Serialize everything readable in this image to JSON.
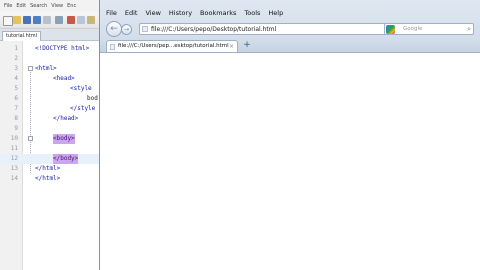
{
  "editor": {
    "menu": [
      "File",
      "Edit",
      "Search",
      "View",
      "Enc"
    ],
    "tab_label": "tutorial.html",
    "lines": [
      {
        "num": "1",
        "text": "<!DOCTYPE html>"
      },
      {
        "num": "2",
        "text": ""
      },
      {
        "num": "3",
        "text": "<html>"
      },
      {
        "num": "4",
        "text": "<head>"
      },
      {
        "num": "5",
        "text": "<style"
      },
      {
        "num": "6",
        "text": "bod"
      },
      {
        "num": "7",
        "text": "</style"
      },
      {
        "num": "8",
        "text": "</head>"
      },
      {
        "num": "9",
        "text": ""
      },
      {
        "num": "10",
        "text": "<body>"
      },
      {
        "num": "11",
        "text": ""
      },
      {
        "num": "12",
        "text": "</body>"
      },
      {
        "num": "13",
        "text": "</html>"
      },
      {
        "num": "14",
        "text": "</html>"
      }
    ]
  },
  "browser": {
    "menu": [
      "File",
      "Edit",
      "View",
      "History",
      "Bookmarks",
      "Tools",
      "Help"
    ],
    "url": "file:///C:/Users/pepo/Desktop/tutorial.html",
    "search_placeholder": "Google",
    "tab_title": "file:///C:/Users/pep...esktop/tutorial.html",
    "tab_close": "×",
    "new_tab": "+",
    "back_icon": "←",
    "forward_icon": "→",
    "star_icon": "☆",
    "refresh_icon": "C",
    "search_icon": "⌕"
  }
}
